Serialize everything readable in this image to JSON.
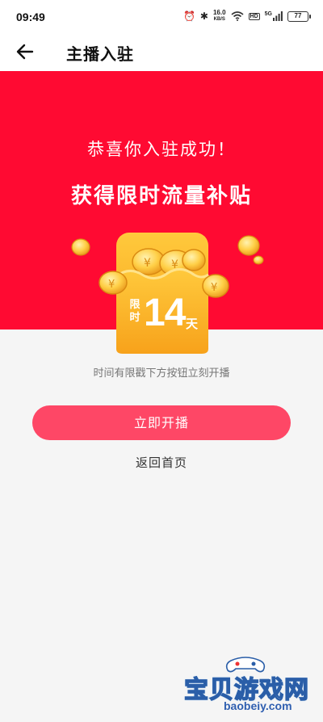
{
  "status_bar": {
    "time": "09:49",
    "alarm_icon": "alarm-icon",
    "bluetooth_icon": "bluetooth-icon",
    "net_speed_value": "16.0",
    "net_speed_unit": "KB/S",
    "wifi_icon": "wifi-icon",
    "hd_badge": "HD",
    "network_type": "5G",
    "signal_icon": "signal-icon",
    "battery_level": "77"
  },
  "header": {
    "back_icon": "back-arrow-icon",
    "title": "主播入驻"
  },
  "banner": {
    "congrats_text": "恭喜你入驻成功！",
    "headline": "获得限时流量补贴",
    "background_color": "#ff0a32"
  },
  "reward": {
    "limit_label": "限时",
    "days": "14",
    "unit": "天",
    "illustration": "coin-envelope-illustration"
  },
  "hint_text": "时间有限戳下方按钮立刻开播",
  "actions": {
    "start_live_label": "立即开播",
    "start_live_color": "#fe4766",
    "back_home_label": "返回首页"
  },
  "watermark": {
    "title": "宝贝游戏网",
    "url": "baobeiy.com",
    "icon": "gamepad-icon"
  }
}
